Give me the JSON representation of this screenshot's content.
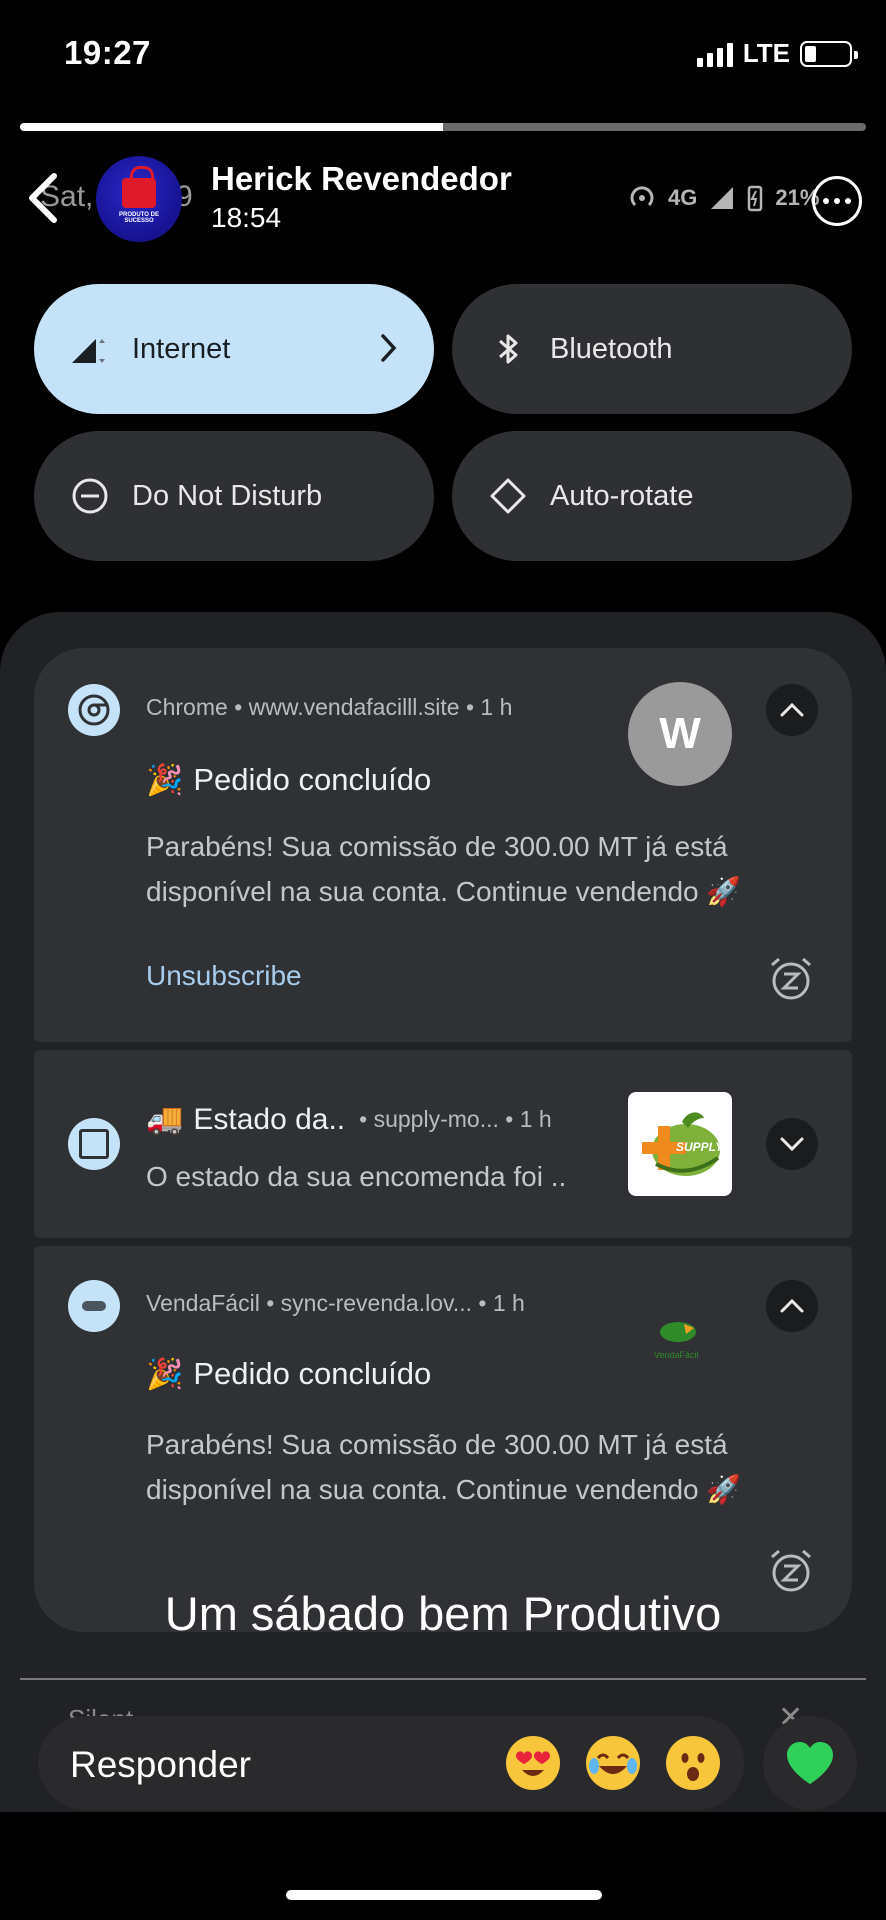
{
  "ios_status": {
    "time": "19:27",
    "network": "LTE",
    "signal_bars": 4,
    "battery_level": 0.25
  },
  "story": {
    "progress": 0.5,
    "user_name": "Herick Revendedor",
    "posted_time": "18:54",
    "caption": "Um sábado bem Produtivo",
    "avatar_text": "PRODUTO DE SUCESSO"
  },
  "android_bg": {
    "date_prefix": "Sat,",
    "date_suffix": "9",
    "network": "4G",
    "battery": "21%"
  },
  "quick_settings": {
    "internet": "Internet",
    "bluetooth": "Bluetooth",
    "dnd": "Do Not Disturb",
    "autorotate": "Auto-rotate"
  },
  "notifications": [
    {
      "app": "Chrome",
      "source": "www.vendafacilll.site",
      "age": "1 h",
      "avatar_letter": "W",
      "title": "Pedido concluído",
      "body": "Parabéns! Sua comissão de 300.00 MT já está disponível na sua conta. Continue vendendo 🚀",
      "action": "Unsubscribe"
    },
    {
      "title": "Estado da..",
      "source": "supply-mo...",
      "age": "1 h",
      "body": "O estado da sua encomenda foi ..",
      "thumb_text": "SUPPLY"
    },
    {
      "app": "VendaFácil",
      "source": "sync-revenda.lov...",
      "age": "1 h",
      "title": "Pedido concluído",
      "body": "Parabéns! Sua comissão de 300.00 MT já está disponível na sua conta. Continue vendendo 🚀",
      "logo_text": "VendaFácil"
    }
  ],
  "shade_peek": {
    "silent_label": "Silent"
  },
  "reply": {
    "placeholder": "Responder",
    "reactions": [
      "heart-eyes",
      "tears-of-joy",
      "surprised"
    ]
  },
  "colors": {
    "active_tile": "#c5e3f8",
    "link": "#a7cdee",
    "heart": "#2fd15a"
  }
}
